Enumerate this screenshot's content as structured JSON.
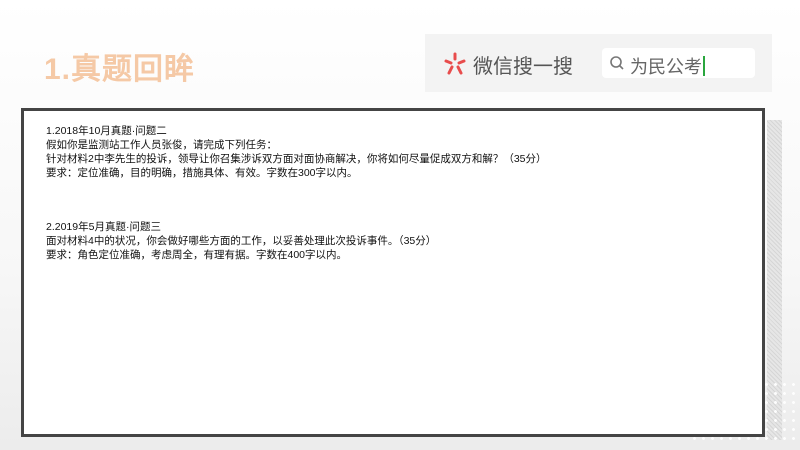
{
  "header": {
    "title": "1.真题回眸"
  },
  "search_banner": {
    "brand": "微信搜一搜",
    "search_text": "为民公考",
    "logo_color": "#e84c4c",
    "caret_color": "#2aa63e"
  },
  "questions": [
    {
      "title": "1.2018年10月真题·问题二",
      "lines": [
        "假如你是监测站工作人员张俊，请完成下列任务：",
        "针对材料2中李先生的投诉，领导让你召集涉诉双方面对面协商解决，你将如何尽量促成双方和解？（35分）",
        "要求：定位准确，目的明确，措施具体、有效。字数在300字以内。"
      ]
    },
    {
      "title": "2.2019年5月真题·问题三",
      "lines": [
        "面对材料4中的状况，你会做好哪些方面的工作，以妥善处理此次投诉事件。（35分）",
        "要求：角色定位准确，考虑周全，有理有据。字数在400字以内。"
      ]
    }
  ]
}
